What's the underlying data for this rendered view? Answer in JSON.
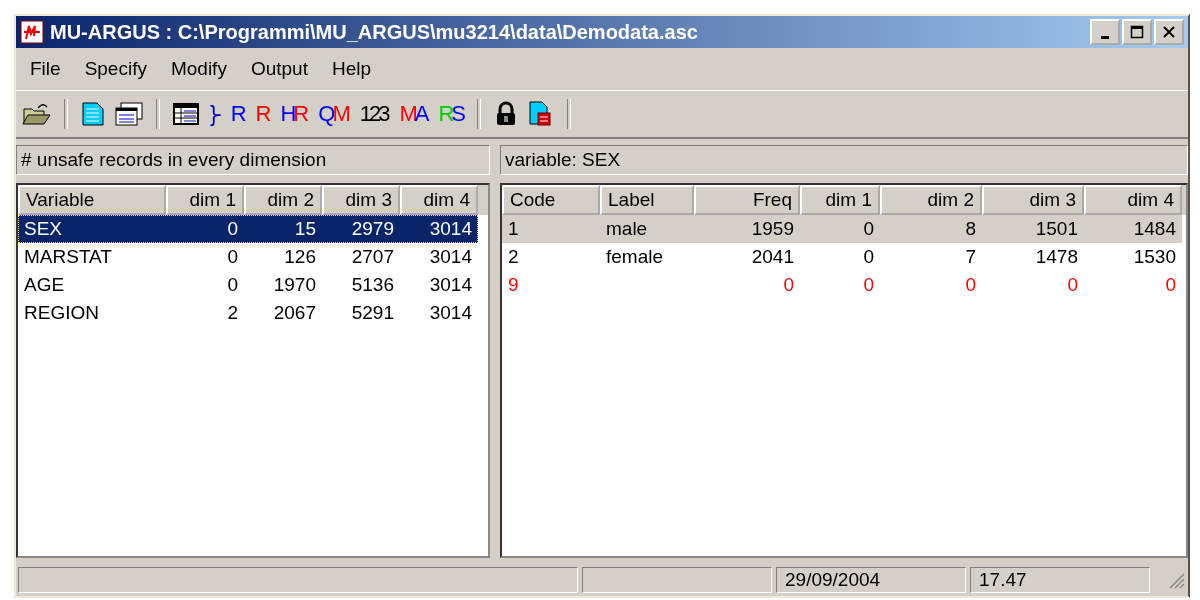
{
  "window": {
    "title": "MU-ARGUS : C:\\Programmi\\MU_ARGUS\\mu3214\\data\\Demodata.asc"
  },
  "menu": [
    "File",
    "Specify",
    "Modify",
    "Output",
    "Help"
  ],
  "toolbar": [
    {
      "kind": "open"
    },
    {
      "kind": "separator"
    },
    {
      "kind": "document"
    },
    {
      "kind": "windows"
    },
    {
      "kind": "separator"
    },
    {
      "kind": "table"
    },
    {
      "kind": "glyph",
      "parts": [
        {
          "text": "}-",
          "color": "#0000c0"
        }
      ]
    },
    {
      "kind": "glyph",
      "parts": [
        {
          "text": "R",
          "color": "#0000ff"
        }
      ]
    },
    {
      "kind": "glyph",
      "parts": [
        {
          "text": "R",
          "color": "#ff0000"
        }
      ]
    },
    {
      "kind": "glyph",
      "parts": [
        {
          "text": "H",
          "color": "#0000ff"
        },
        {
          "text": "R",
          "color": "#ff0000"
        }
      ]
    },
    {
      "kind": "glyph",
      "parts": [
        {
          "text": "Q",
          "color": "#0000ff"
        },
        {
          "text": "M",
          "color": "#ff0000"
        }
      ]
    },
    {
      "kind": "glyph",
      "parts": [
        {
          "text": "123",
          "color": "#000000"
        }
      ]
    },
    {
      "kind": "glyph",
      "parts": [
        {
          "text": "M",
          "color": "#ff0000"
        },
        {
          "text": "A",
          "color": "#0000ff"
        }
      ]
    },
    {
      "kind": "glyph",
      "parts": [
        {
          "text": "R",
          "color": "#00cc00"
        },
        {
          "text": "S",
          "color": "#0000ff"
        }
      ]
    },
    {
      "kind": "separator"
    },
    {
      "kind": "lock"
    },
    {
      "kind": "report"
    },
    {
      "kind": "separator"
    }
  ],
  "left_panel": {
    "caption": "# unsafe records in every dimension",
    "columns": [
      "Variable",
      "dim 1",
      "dim 2",
      "dim 3",
      "dim 4"
    ],
    "rows": [
      {
        "cells": [
          "SEX",
          "0",
          "15",
          "2979",
          "3014"
        ],
        "selected": true
      },
      {
        "cells": [
          "MARSTAT",
          "0",
          "126",
          "2707",
          "3014"
        ],
        "selected": false
      },
      {
        "cells": [
          "AGE",
          "0",
          "1970",
          "5136",
          "3014"
        ],
        "selected": false
      },
      {
        "cells": [
          "REGION",
          "2",
          "2067",
          "5291",
          "3014"
        ],
        "selected": false
      }
    ]
  },
  "right_panel": {
    "caption": "variable: SEX",
    "columns": [
      "Code",
      "Label",
      "Freq",
      "dim 1",
      "dim 2",
      "dim 3",
      "dim 4"
    ],
    "rows": [
      {
        "cells": [
          "1",
          "male",
          "1959",
          "0",
          "8",
          "1501",
          "1484"
        ],
        "selected": true,
        "missing": false
      },
      {
        "cells": [
          "2",
          "female",
          "2041",
          "0",
          "7",
          "1478",
          "1530"
        ],
        "selected": false,
        "missing": false
      },
      {
        "cells": [
          "9",
          "",
          "0",
          "0",
          "0",
          "0",
          "0"
        ],
        "selected": false,
        "missing": true
      }
    ]
  },
  "status_bar": [
    "29/09/2004",
    "17.47"
  ]
}
